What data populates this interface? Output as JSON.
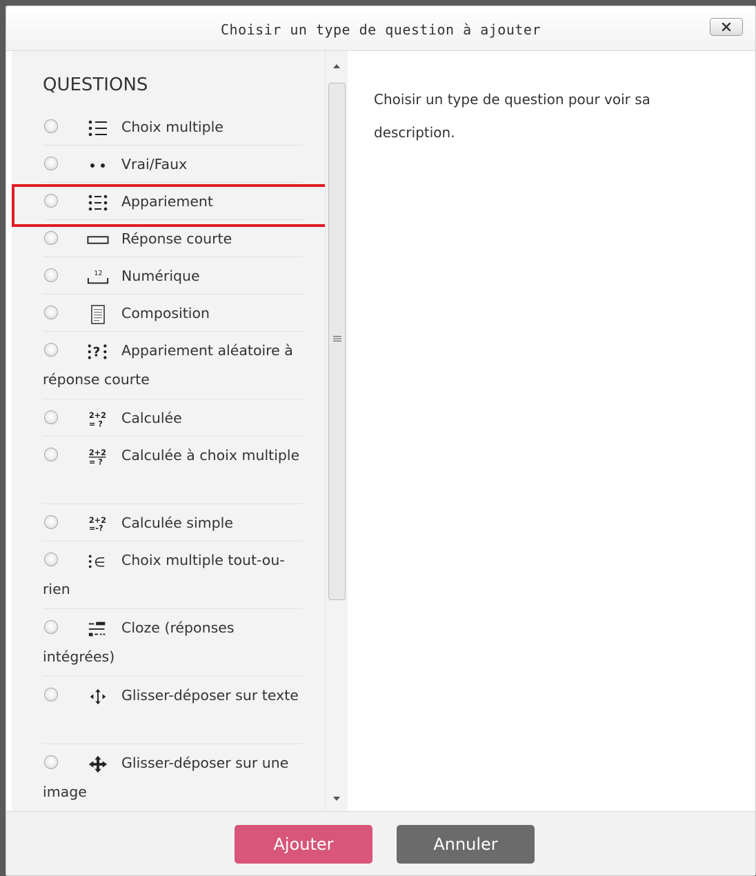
{
  "dialog": {
    "title": "Choisir un type de question à ajouter",
    "close_label": "✕"
  },
  "left": {
    "section_title": "QUESTIONS",
    "options": [
      {
        "label": "Choix multiple",
        "icon": "list-icon"
      },
      {
        "label": "Vrai/Faux",
        "icon": "two-dots-icon"
      },
      {
        "label": "Appariement",
        "icon": "matching-icon"
      },
      {
        "label": "Réponse courte",
        "icon": "short-answer-icon"
      },
      {
        "label": "Numérique",
        "icon": "numeric-icon"
      },
      {
        "label": "Composition",
        "icon": "essay-icon"
      },
      {
        "label": "Appariement aléatoire à réponse courte",
        "icon": "random-matching-icon"
      },
      {
        "label": "Calculée",
        "icon": "calculated-icon"
      },
      {
        "label": "Calculée à choix multiple",
        "icon": "calculated-multichoice-icon"
      },
      {
        "label": "Calculée simple",
        "icon": "calculated-simple-icon"
      },
      {
        "label": "Choix multiple tout-ou-rien",
        "icon": "all-or-nothing-icon"
      },
      {
        "label": "Cloze (réponses intégrées)",
        "icon": "cloze-icon"
      },
      {
        "label": "Glisser-déposer sur texte",
        "icon": "drag-text-icon"
      },
      {
        "label": "Glisser-déposer sur une image",
        "icon": "drag-image-icon"
      }
    ]
  },
  "right": {
    "description": "Choisir un type de question pour voir sa description."
  },
  "footer": {
    "add_label": "Ajouter",
    "cancel_label": "Annuler"
  },
  "colors": {
    "add_button": "#d75679",
    "cancel_button": "#6b6b6b",
    "highlight": "#e21b23"
  }
}
